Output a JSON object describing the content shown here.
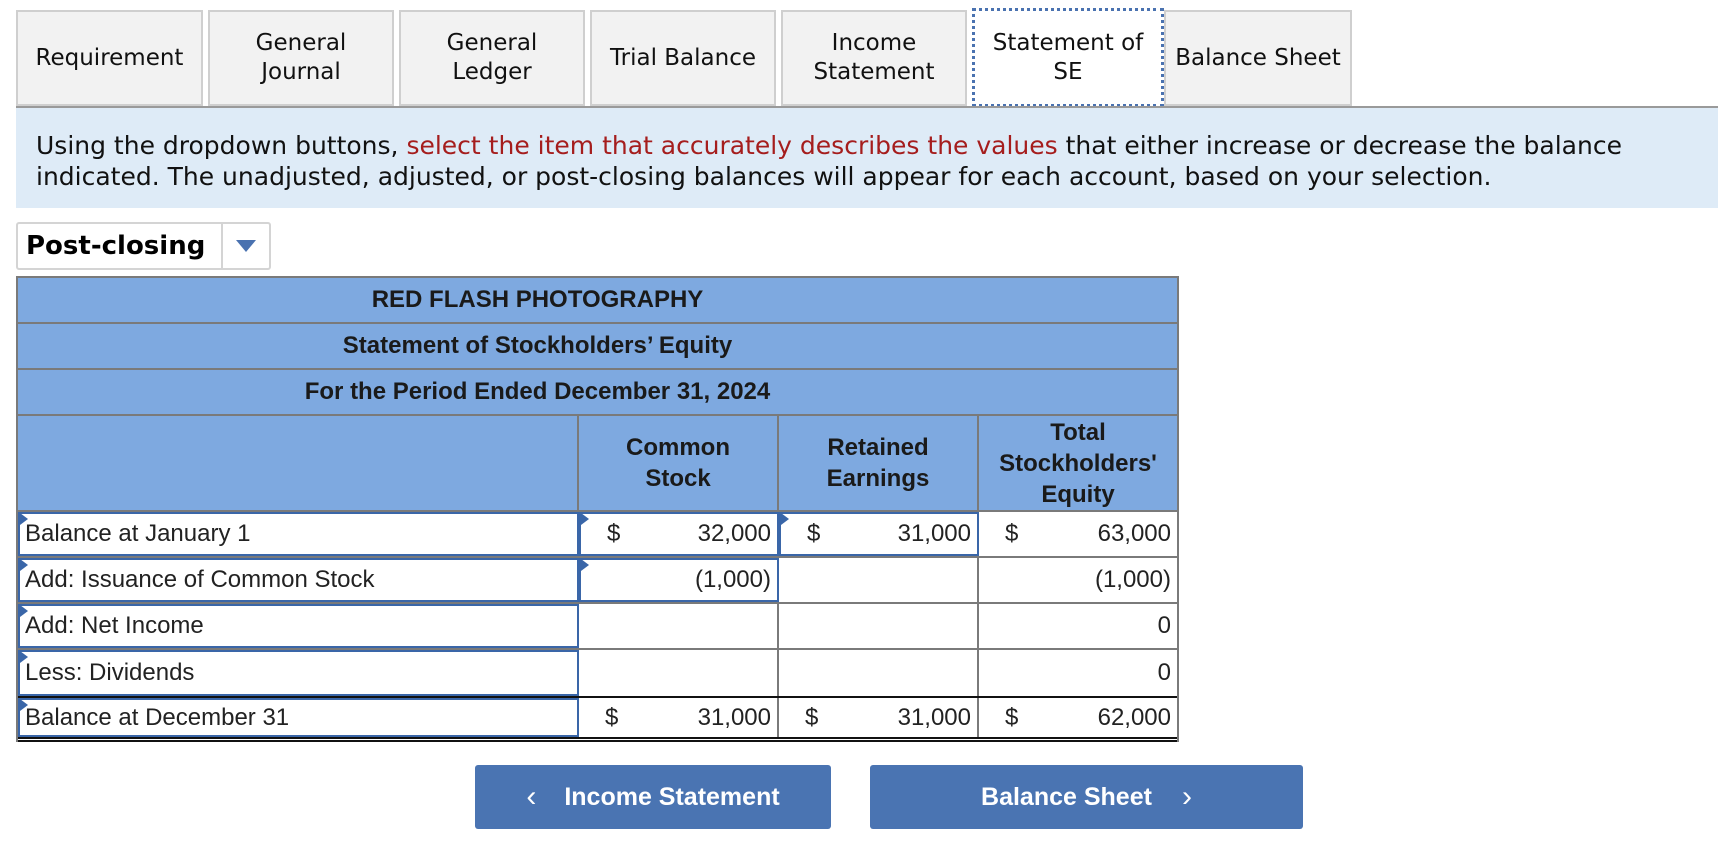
{
  "tabs": [
    {
      "label": "Requirement",
      "active": false
    },
    {
      "label": "General\nJournal",
      "active": false
    },
    {
      "label": "General\nLedger",
      "active": false
    },
    {
      "label": "Trial Balance",
      "active": false
    },
    {
      "label": "Income\nStatement",
      "active": false
    },
    {
      "label": "Statement of\nSE",
      "active": true
    },
    {
      "label": "Balance Sheet",
      "active": false
    }
  ],
  "instructions": {
    "part1": "Using the dropdown buttons, ",
    "highlight": "select the item that accurately describes the values",
    "part2": " that either increase or decrease the  balance indicated. The unadjusted, adjusted, or post-closing balances will appear for each account, based on your selection.",
    "highlight_color": "#a51d1d"
  },
  "balance_dropdown": {
    "selected": "Post-closing",
    "icon": "caret-down-icon"
  },
  "statement": {
    "company": "RED FLASH PHOTOGRAPHY",
    "title": "Statement of Stockholders’ Equity",
    "period": "For the Period Ended December 31, 2024",
    "columns": [
      "Common\nStock",
      "Retained\nEarnings",
      "Total\nStockholders'\nEquity"
    ],
    "rows": [
      {
        "label": "Balance at January 1",
        "cells": [
          {
            "dollar": "$",
            "value": "32,000"
          },
          {
            "dollar": "$",
            "value": "31,000"
          },
          {
            "dollar": "$",
            "value": "63,000"
          }
        ]
      },
      {
        "label": "Add: Issuance of Common Stock",
        "cells": [
          {
            "dollar": "",
            "value": "(1,000)"
          },
          {
            "dollar": "",
            "value": ""
          },
          {
            "dollar": "",
            "value": "(1,000)"
          }
        ]
      },
      {
        "label": "Add: Net Income",
        "cells": [
          {
            "dollar": "",
            "value": ""
          },
          {
            "dollar": "",
            "value": ""
          },
          {
            "dollar": "",
            "value": "0"
          }
        ]
      },
      {
        "label": "Less: Dividends",
        "cells": [
          {
            "dollar": "",
            "value": ""
          },
          {
            "dollar": "",
            "value": ""
          },
          {
            "dollar": "",
            "value": "0"
          }
        ]
      },
      {
        "label": "Balance at December 31",
        "cells": [
          {
            "dollar": "$",
            "value": "31,000"
          },
          {
            "dollar": "$",
            "value": "31,000"
          },
          {
            "dollar": "$",
            "value": "62,000"
          }
        ]
      }
    ]
  },
  "nav": {
    "prev_label": "Income Statement",
    "next_label": "Balance Sheet",
    "prev_icon": "‹",
    "next_icon": "›"
  },
  "colors": {
    "header_blue": "#7ea9e0",
    "button_blue": "#4a74b2",
    "info_bg": "#deebf7",
    "input_border": "#3a66a8"
  }
}
